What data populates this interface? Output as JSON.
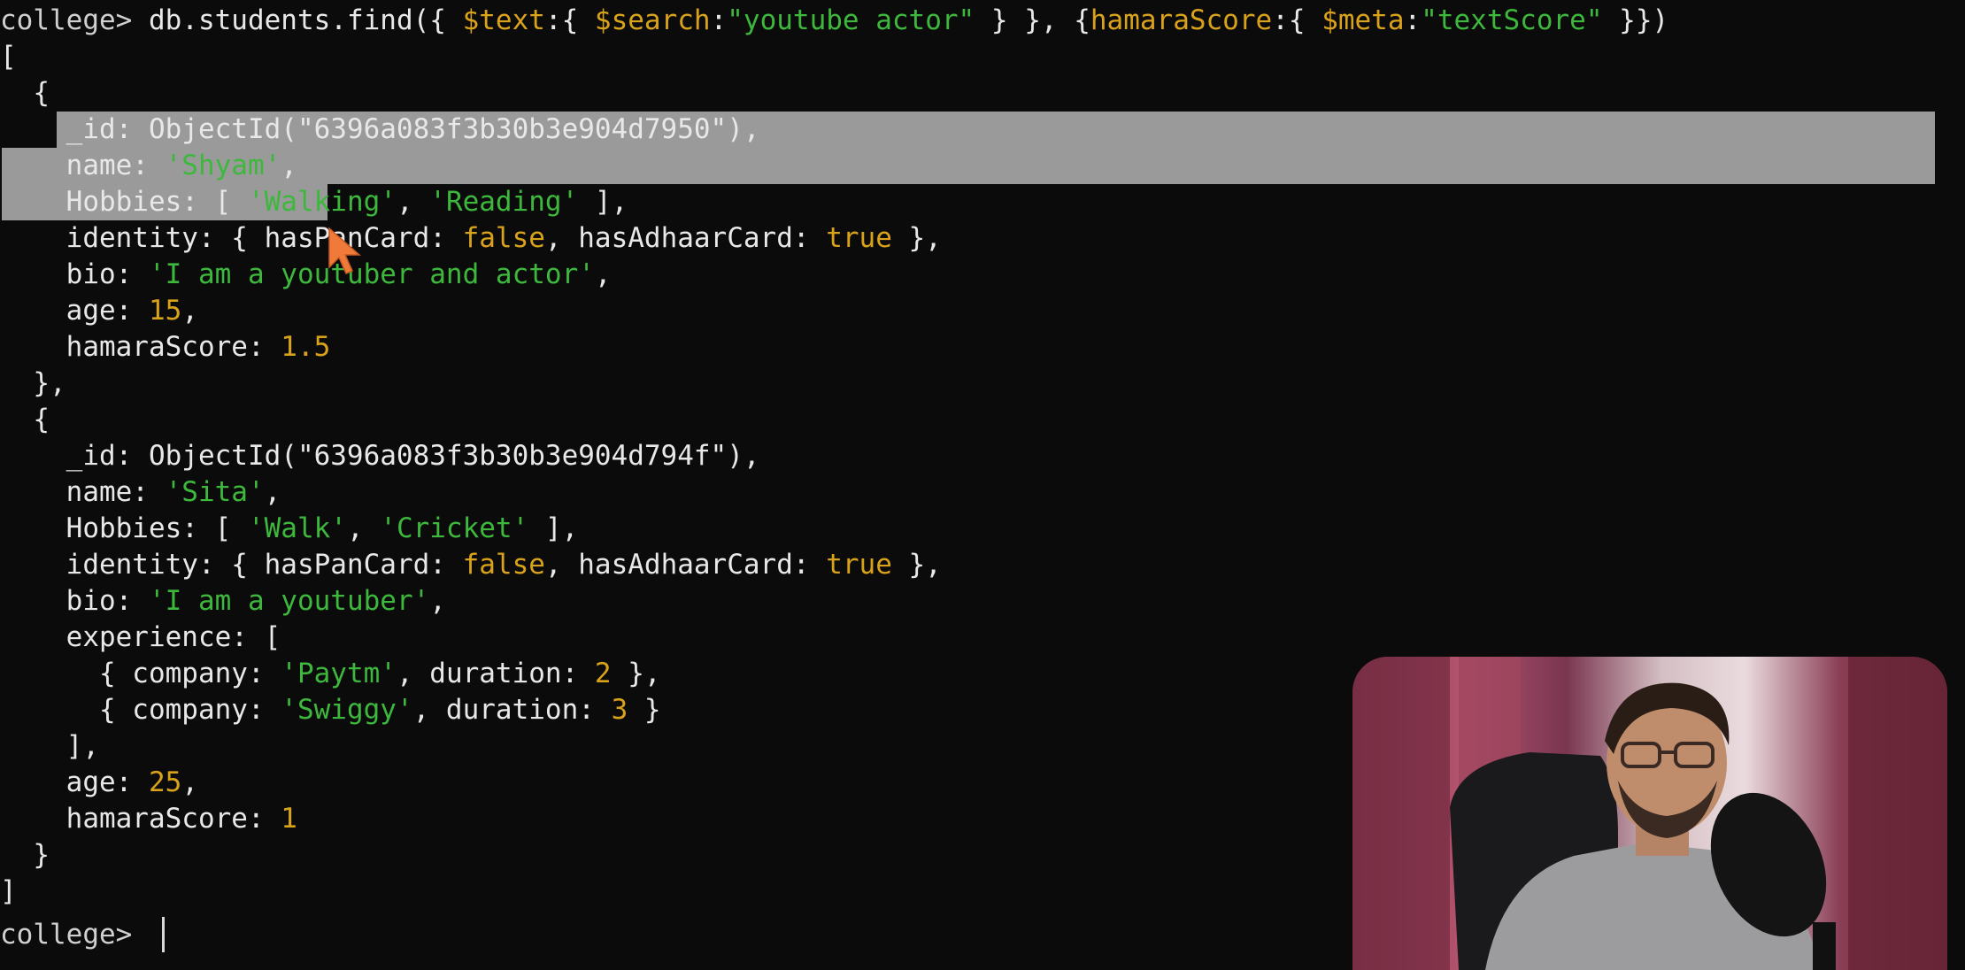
{
  "terminal": {
    "prompt": "college> ",
    "command": {
      "db": "db.students.find({ ",
      "text_op": "$text",
      "a": ":{ ",
      "search_op": "$search",
      "b": ":",
      "search_value": "\"youtube actor\"",
      "c": " } }, {",
      "score_field": "hamaraScore",
      "d": ":{ ",
      "meta_op": "$meta",
      "e": ":",
      "meta_value": "\"textScore\"",
      "f": " }})"
    },
    "open_bracket": "[",
    "close_bracket": "]",
    "open_brace": "{",
    "close_brace_comma": "},",
    "close_brace": "}",
    "results": [
      {
        "id_line": "_id: ObjectId(\"6396a083f3b30b3e904d7950\"),",
        "name_key": "name: ",
        "name_val": "'Shyam'",
        "hobbies_key": "Hobbies: [ ",
        "hobby1": "'Walking'",
        "hobby2": "'Reading'",
        "identity_key": "identity: { hasPanCard: ",
        "has_pan": "false",
        "adhaar_key": ", hasAdhaarCard: ",
        "has_adhaar": "true",
        "bio_key": "bio: ",
        "bio_val": "'I am a youtuber and actor'",
        "age_key": "age: ",
        "age_val": "15",
        "score_key": "hamaraScore: ",
        "score_val": "1.5"
      },
      {
        "id_line": "_id: ObjectId(\"6396a083f3b30b3e904d794f\"),",
        "name_key": "name: ",
        "name_val": "'Sita'",
        "hobbies_key": "Hobbies: [ ",
        "hobby1": "'Walk'",
        "hobby2": "'Cricket'",
        "identity_key": "identity: { hasPanCard: ",
        "has_pan": "false",
        "adhaar_key": ", hasAdhaarCard: ",
        "has_adhaar": "true",
        "bio_key": "bio: ",
        "bio_val": "'I am a youtuber'",
        "experience_key": "experience: [",
        "experience": [
          {
            "company_key": "{ company: ",
            "company": "'Paytm'",
            "duration_key": ", duration: ",
            "duration": "2"
          },
          {
            "company_key": "{ company: ",
            "company": "'Swiggy'",
            "duration_key": ", duration: ",
            "duration": "3"
          }
        ],
        "experience_close": "],",
        "age_key": "age: ",
        "age_val": "25",
        "score_key": "hamaraScore: ",
        "score_val": "1"
      }
    ]
  },
  "colors": {
    "background": "#0b0b0b",
    "string": "#3db83d",
    "number": "#d9a21b",
    "selection": "#9a9a9a",
    "pointer": "#f07a3a"
  },
  "icons": {
    "pointer": "mouse-pointer-icon"
  }
}
